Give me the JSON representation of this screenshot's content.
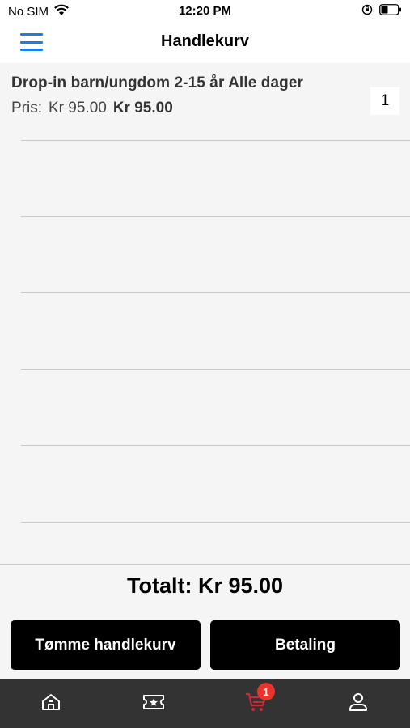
{
  "status_bar": {
    "carrier": "No SIM",
    "time": "12:20 PM"
  },
  "nav": {
    "title": "Handlekurv",
    "menu_icon": "hamburger-menu-icon"
  },
  "cart": {
    "items": [
      {
        "name": "Drop-in barn/ungdom 2-15 år Alle dager",
        "price_label": "Pris:",
        "unit_price": "Kr 95.00",
        "line_total": "Kr 95.00",
        "quantity": "1"
      }
    ]
  },
  "summary": {
    "total": "Totalt: Kr 95.00"
  },
  "actions": {
    "clear_label": "Tømme handlekurv",
    "pay_label": "Betaling"
  },
  "tab_bar": {
    "tabs": [
      {
        "icon": "home-icon",
        "active": false
      },
      {
        "icon": "ticket-icon",
        "active": false
      },
      {
        "icon": "cart-icon",
        "active": true,
        "badge": "1"
      },
      {
        "icon": "profile-icon",
        "active": false
      }
    ],
    "active_color": "#c62a3b",
    "inactive_color": "#ffffff"
  },
  "colors": {
    "accent": "#1a7fe8",
    "button_bg": "#000000",
    "badge": "#e8342b"
  }
}
